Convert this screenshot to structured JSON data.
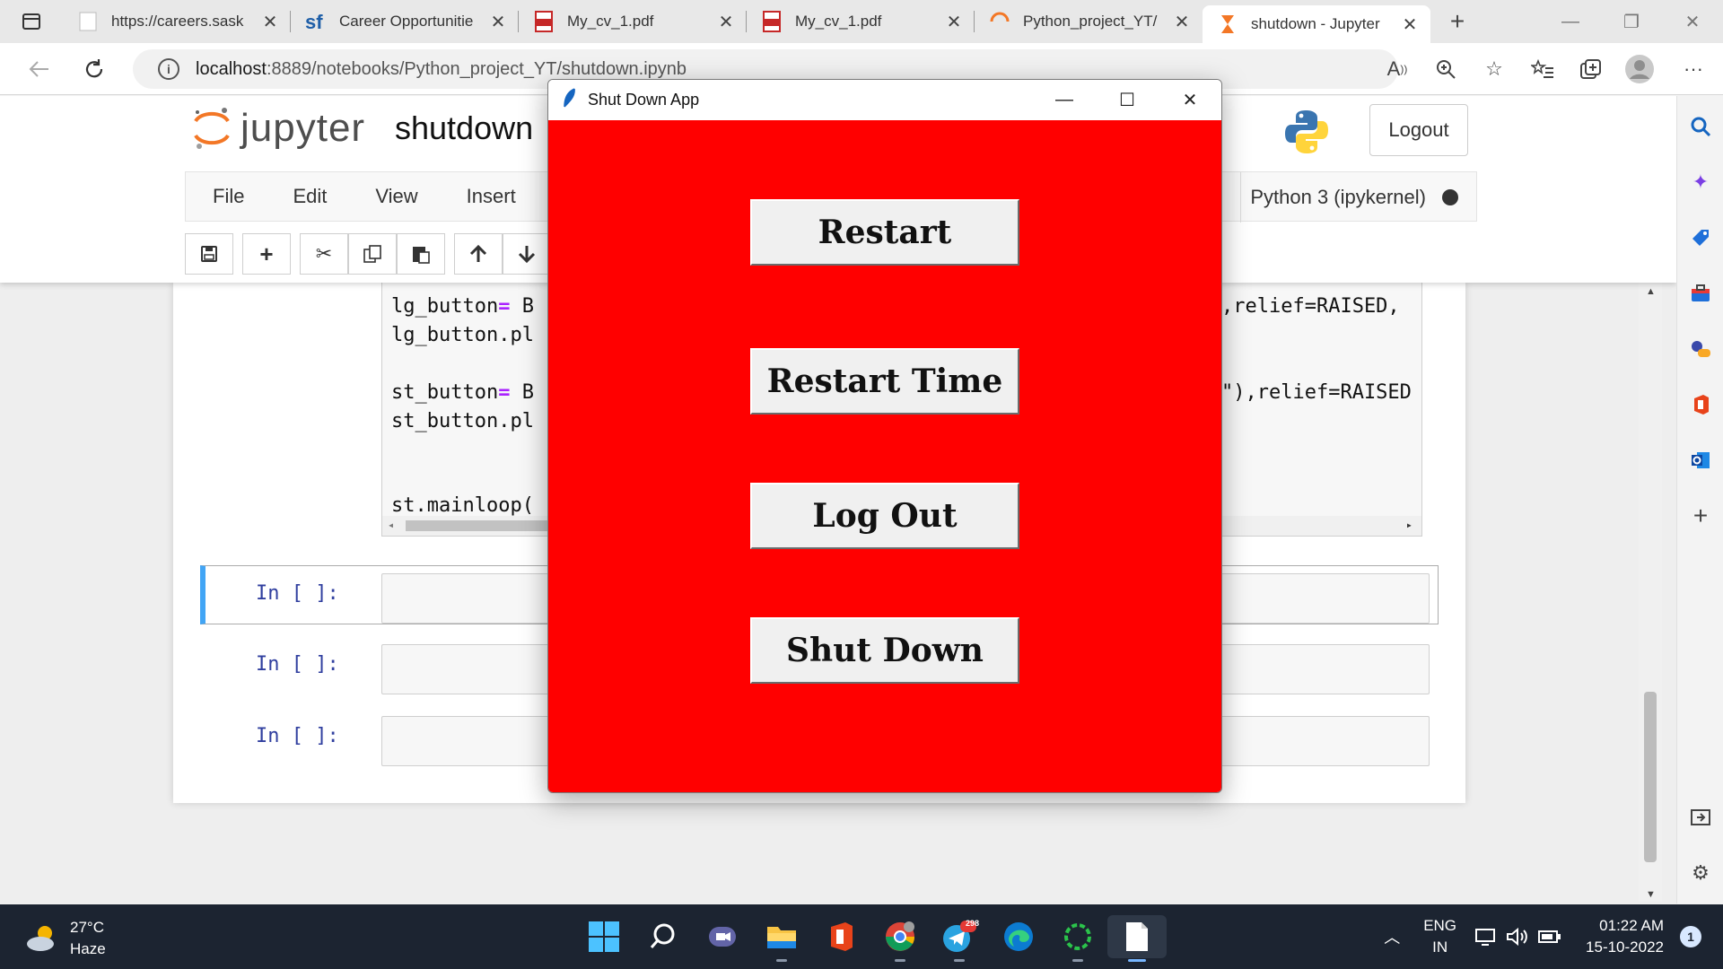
{
  "browser": {
    "tabs": [
      {
        "title": "https://careers.sask"
      },
      {
        "title": "Career Opportunitie"
      },
      {
        "title": "My_cv_1.pdf"
      },
      {
        "title": "My_cv_1.pdf"
      },
      {
        "title": "Python_project_YT/"
      },
      {
        "title": "shutdown - Jupyter",
        "active": true
      }
    ],
    "new_tab_icon": "+",
    "url": {
      "host": "localhost",
      "path": ":8889/notebooks/Python_project_YT/shutdown.ipynb"
    }
  },
  "jupyter": {
    "logo_text": "jupyter",
    "notebook_name": "shutdown",
    "logout_label": "Logout",
    "menus": [
      "File",
      "Edit",
      "View",
      "Insert"
    ],
    "kernel": "Python 3 (ipykernel)",
    "code_lines": [
      {
        "left": "lg_button",
        "op": "=",
        "rest": " B",
        "right": ",relief=RAISED,"
      },
      {
        "left": "lg_button.pl",
        "op": "",
        "rest": "",
        "right": ""
      },
      {
        "left": "",
        "op": "",
        "rest": "",
        "right": ""
      },
      {
        "left": "st_button",
        "op": "=",
        "rest": " B",
        "right": "\"),relief=RAISED"
      },
      {
        "left": "st_button.pl",
        "op": "",
        "rest": "",
        "right": ""
      },
      {
        "left": "",
        "op": "",
        "rest": "",
        "right": ""
      },
      {
        "left": "",
        "op": "",
        "rest": "",
        "right": ""
      },
      {
        "left": "st.mainloop(",
        "op": "",
        "rest": "",
        "right": ""
      }
    ],
    "cell_prompt": "In [ ]:"
  },
  "tk_window": {
    "title": "Shut Down App",
    "background": "#ff0000",
    "buttons": [
      "Restart",
      "Restart Time",
      "Log Out",
      "Shut Down"
    ]
  },
  "taskbar": {
    "weather_temp": "27°C",
    "weather_desc": "Haze",
    "telegram_badge": "298",
    "lang_top": "ENG",
    "lang_bottom": "IN",
    "time": "01:22 AM",
    "date": "15-10-2022",
    "notification_count": "1"
  }
}
